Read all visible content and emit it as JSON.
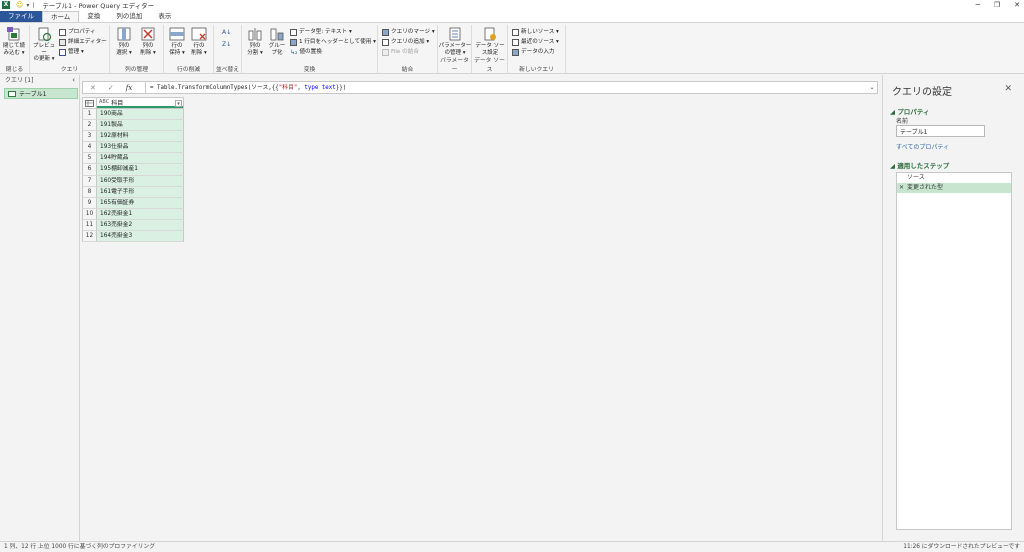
{
  "window": {
    "title": "テーブル1 - Power Query エディター",
    "minimize": "─",
    "restore": "❐",
    "close": "✕"
  },
  "tabs": [
    "ファイル",
    "ホーム",
    "変換",
    "列の追加",
    "表示"
  ],
  "ribbon": {
    "close_group": {
      "label": "閉じる",
      "close_load": [
        "閉じて読",
        "み込む ▾"
      ]
    },
    "query_group": {
      "label": "クエリ",
      "preview_refresh": [
        "プレビュー",
        "の更新 ▾"
      ],
      "properties": "プロパティ",
      "advanced_editor": "詳細エディター",
      "manage": "管理 ▾"
    },
    "column_manage_group": {
      "label": "列の管理",
      "choose_columns": [
        "列の",
        "選択 ▾"
      ],
      "remove_columns": [
        "列の",
        "削除 ▾"
      ]
    },
    "row_reduce_group": {
      "label": "行の削減",
      "keep_rows": [
        "行の",
        "保持 ▾"
      ],
      "remove_rows": [
        "行の",
        "削除 ▾"
      ]
    },
    "sort_group": {
      "label": "並べ替え"
    },
    "transform_group": {
      "label": "変換",
      "split_column": [
        "列の",
        "分割 ▾"
      ],
      "group_by": [
        "グルー",
        "プ化"
      ],
      "data_type": "データ型: テキスト ▾",
      "first_row_header": "1 行目をヘッダーとして使用 ▾",
      "replace_values": "値の置換"
    },
    "combine_group": {
      "label": "結合",
      "merge_queries": "クエリのマージ ▾",
      "append_queries": "クエリの追加 ▾",
      "combine_files": "File の結合"
    },
    "parameters_group": {
      "label": "パラメーター",
      "manage_params": [
        "パラメーター",
        "の管理 ▾"
      ]
    },
    "datasource_group": {
      "label": "データ ソース",
      "ds_settings": [
        "データ ソー",
        "ス設定"
      ]
    },
    "newquery_group": {
      "label": "新しいクエリ",
      "new_source": "新しいソース ▾",
      "recent_sources": "最近のソース ▾",
      "enter_data": "データの入力"
    }
  },
  "queries_panel": {
    "header": "クエリ [1]",
    "collapse": "‹",
    "items": [
      "テーブル1"
    ]
  },
  "formula_bar": {
    "cancel": "✕",
    "commit": "✓",
    "fx": "fx",
    "p1": "= Table.TransformColumnTypes(ソース,{{",
    "p2": "\"科目\"",
    "p3": ", ",
    "p4": "type text",
    "p5": "}})",
    "expand": "⌄"
  },
  "grid": {
    "column_type": "ABC",
    "column_header": "科目",
    "dropdown": "▾",
    "rows": [
      {
        "n": "1",
        "v": "190商品"
      },
      {
        "n": "2",
        "v": "191製品"
      },
      {
        "n": "3",
        "v": "192原材料"
      },
      {
        "n": "4",
        "v": "193仕掛品"
      },
      {
        "n": "5",
        "v": "194貯蔵品"
      },
      {
        "n": "6",
        "v": "195棚卸減産1"
      },
      {
        "n": "7",
        "v": "160受取手形"
      },
      {
        "n": "8",
        "v": "161電子手形"
      },
      {
        "n": "9",
        "v": "165有価証券"
      },
      {
        "n": "10",
        "v": "162売掛金1"
      },
      {
        "n": "11",
        "v": "163売掛金2"
      },
      {
        "n": "12",
        "v": "164売掛金3"
      }
    ]
  },
  "settings": {
    "title": "クエリの設定",
    "close": "✕",
    "properties_head": "◢ プロパティ",
    "name_label": "名前",
    "name_value": "テーブル1",
    "all_properties": "すべてのプロパティ",
    "applied_steps_head": "◢ 適用したステップ",
    "steps": [
      {
        "label": "ソース",
        "selected": false
      },
      {
        "label": "変更された型",
        "selected": true
      }
    ]
  },
  "status": {
    "cols_rows": "1 列、12 行",
    "profiling": "上位 1000 行に基づく列のプロファイリング",
    "download": "11:26 にダウンロードされたプレビューです"
  }
}
